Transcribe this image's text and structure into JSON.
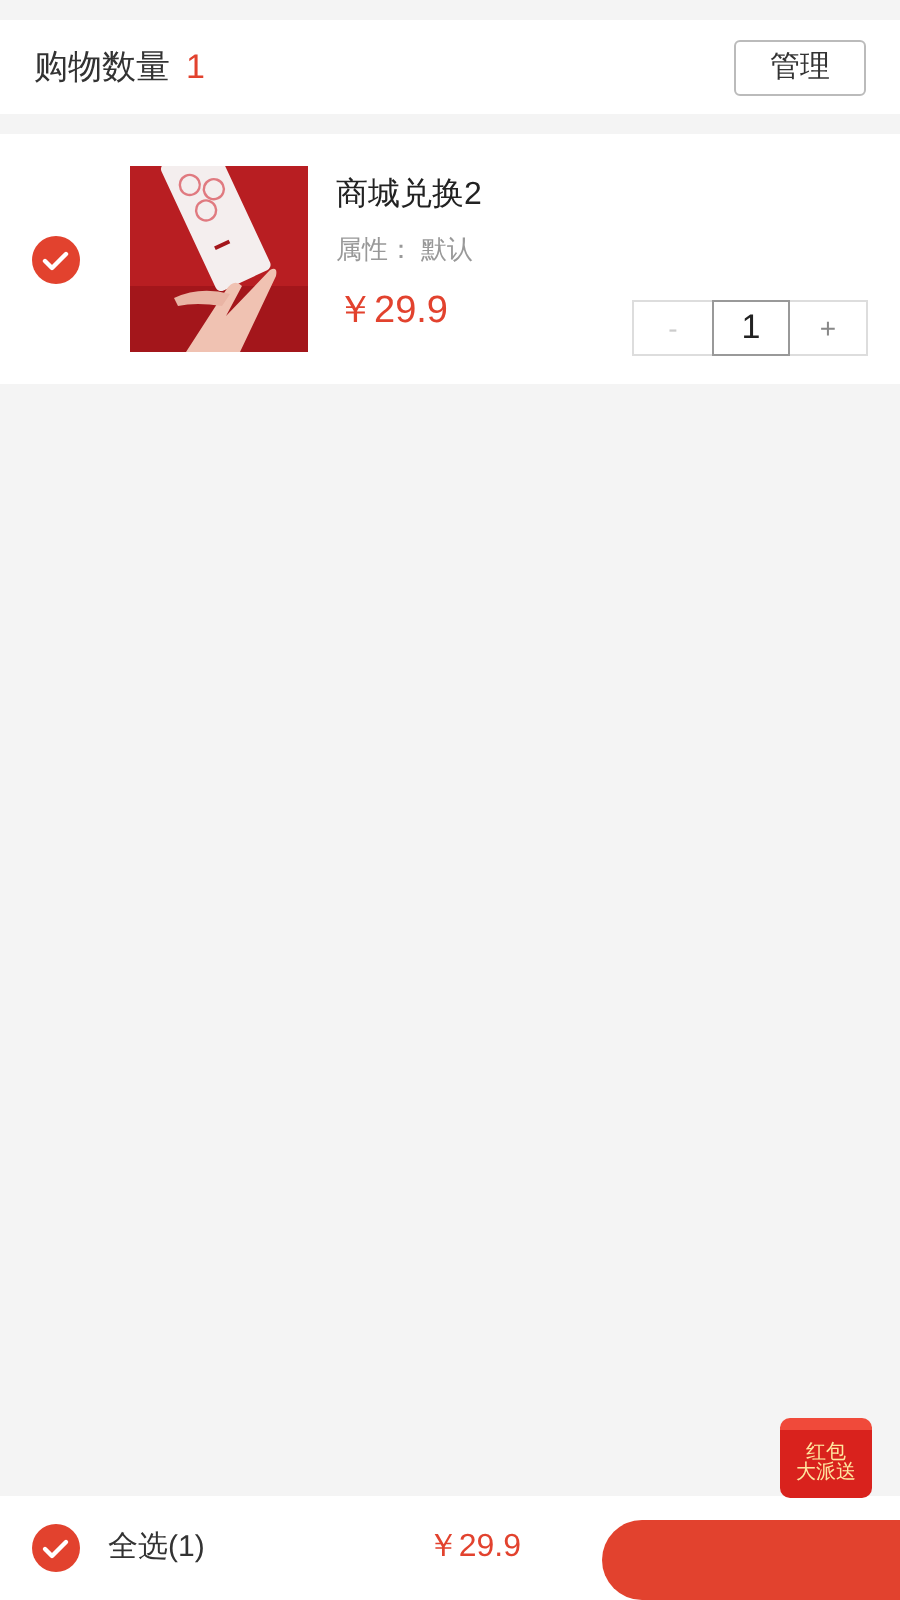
{
  "header": {
    "title": "购物数量",
    "count": "1",
    "manage_button": "管理"
  },
  "items": [
    {
      "name": "商城兑换2",
      "attribute": "属性： 默认",
      "price": "￥29.9",
      "quantity": "1",
      "minus": "-",
      "plus": "+",
      "selected": true
    }
  ],
  "promo_badge": {
    "lines": [
      "红包",
      "大派送"
    ]
  },
  "footer": {
    "select_all": {
      "label": "全选(1)",
      "selected": true
    },
    "total": "￥29.9"
  }
}
